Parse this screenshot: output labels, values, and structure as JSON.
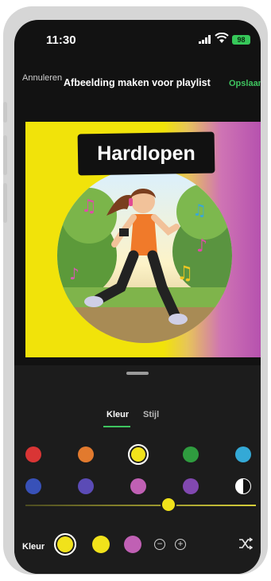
{
  "status": {
    "time": "11:30",
    "battery": "98"
  },
  "header": {
    "cancel_label": "Annuleren",
    "title": "Afbeelding maken voor playlist",
    "save_label": "Opslaan"
  },
  "artwork": {
    "playlist_name": "Hardlopen"
  },
  "sheet": {
    "tabs": [
      {
        "label": "Kleur",
        "active": true
      },
      {
        "label": "Stijl",
        "active": false
      }
    ],
    "palette": [
      {
        "name": "red",
        "color": "#d93535"
      },
      {
        "name": "orange",
        "color": "#e27a2e"
      },
      {
        "name": "yellow",
        "color": "#f1e21b",
        "selected": true
      },
      {
        "name": "green",
        "color": "#2f9c3f"
      },
      {
        "name": "light-blue",
        "color": "#34a9d6"
      },
      {
        "name": "blue",
        "color": "#3851b8"
      },
      {
        "name": "indigo",
        "color": "#5b4bb6"
      },
      {
        "name": "pink",
        "color": "#c060b4"
      },
      {
        "name": "purple",
        "color": "#8148b0"
      },
      {
        "name": "contrast",
        "color": "#ffffff"
      }
    ],
    "slider_value": 0.62,
    "color_row_label": "Kleur",
    "chosen_colors": [
      "#f1e21b",
      "#f1e21b",
      "#c060b4"
    ]
  },
  "colors": {
    "accent": "#3ec45f",
    "background": "#121212",
    "sheet": "#1c1c1c"
  }
}
